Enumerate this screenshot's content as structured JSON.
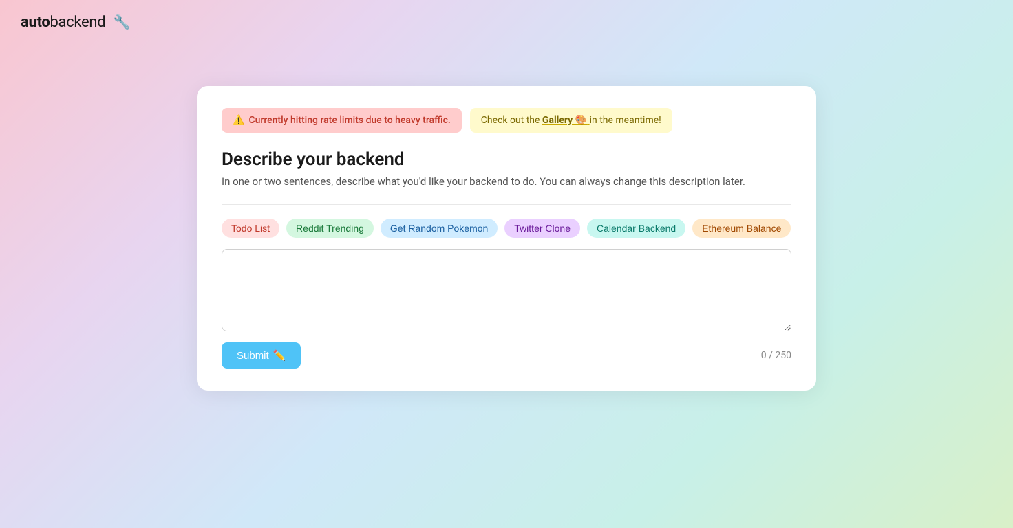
{
  "header": {
    "logo_auto": "auto",
    "logo_backend": "backend",
    "logo_icon": "🔧"
  },
  "alert": {
    "rate_limit_icon": "⚠️",
    "rate_limit_text": "Currently hitting rate limits due to heavy traffic.",
    "gallery_prefix": "Check out the",
    "gallery_link_text": "Gallery 🎨",
    "gallery_suffix": "in the meantime!"
  },
  "main": {
    "title": "Describe your backend",
    "subtitle": "In one or two sentences, describe what you'd like your backend to do. You can always change this description later.",
    "chips": [
      {
        "label": "Todo List",
        "color_class": "chip-red"
      },
      {
        "label": "Reddit Trending",
        "color_class": "chip-green"
      },
      {
        "label": "Get Random Pokemon",
        "color_class": "chip-blue"
      },
      {
        "label": "Twitter Clone",
        "color_class": "chip-purple"
      },
      {
        "label": "Calendar Backend",
        "color_class": "chip-teal"
      },
      {
        "label": "Ethereum Balance",
        "color_class": "chip-orange"
      }
    ],
    "textarea_placeholder": "",
    "textarea_value": "",
    "submit_label": "Submit",
    "submit_icon": "✏️",
    "char_count": "0 / 250"
  }
}
